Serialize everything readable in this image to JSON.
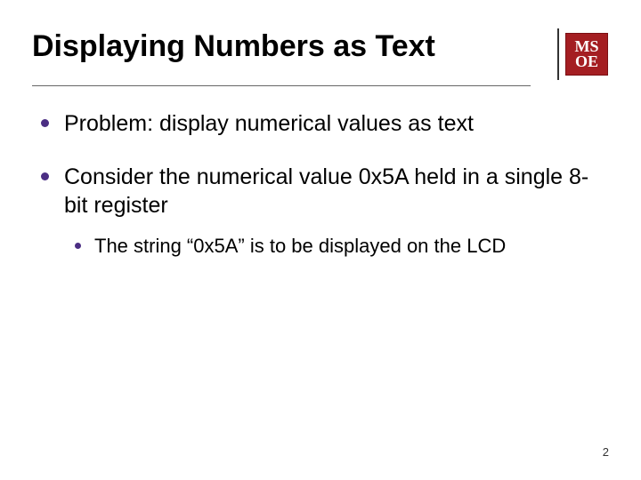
{
  "slide": {
    "title": "Displaying Numbers as Text",
    "logo": {
      "line1": "MS",
      "line2": "OE"
    },
    "bullets": [
      {
        "text": "Problem: display numerical values as text"
      },
      {
        "text": "Consider the numerical value 0x5A held in a single 8-bit register",
        "sub": [
          {
            "text": "The string “0x5A” is to be displayed on the LCD"
          }
        ]
      }
    ],
    "page_number": "2"
  }
}
